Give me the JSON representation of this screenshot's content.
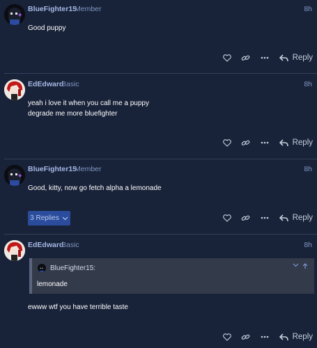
{
  "posts": [
    {
      "user": "BlueFighter15",
      "rank": "Member",
      "time": "8h",
      "lines": [
        "Good puppy"
      ],
      "avatar": "bluefighter-avatar"
    },
    {
      "user": "EdEdward",
      "rank": "Basic",
      "time": "8h",
      "lines": [
        "yeah i love it when you call me a puppy",
        "degrade me more bluefighter"
      ],
      "avatar": "ededward-avatar"
    },
    {
      "user": "BlueFighter15",
      "rank": "Member",
      "time": "8h",
      "lines": [
        "Good, kitty, now go fetch alpha a lemonade"
      ],
      "replies_label": "3 Replies",
      "avatar": "bluefighter-avatar"
    },
    {
      "user": "EdEdward",
      "rank": "Basic",
      "time": "8h",
      "quote": {
        "user": "BlueFighter15:",
        "text": "lemonade"
      },
      "lines": [
        "ewww wtf you have terrible taste"
      ],
      "avatar": "ededward-avatar"
    }
  ],
  "actions": {
    "like_icon": "heart-icon",
    "link_icon": "link-icon",
    "more_icon": "ellipsis-icon",
    "reply_label": "Reply"
  },
  "colors": {
    "background": "#182238",
    "username": "#a6b8e6",
    "meta": "#8397c4",
    "replies_button": "#2b4c9c",
    "quote_bg": "#333a4a"
  }
}
